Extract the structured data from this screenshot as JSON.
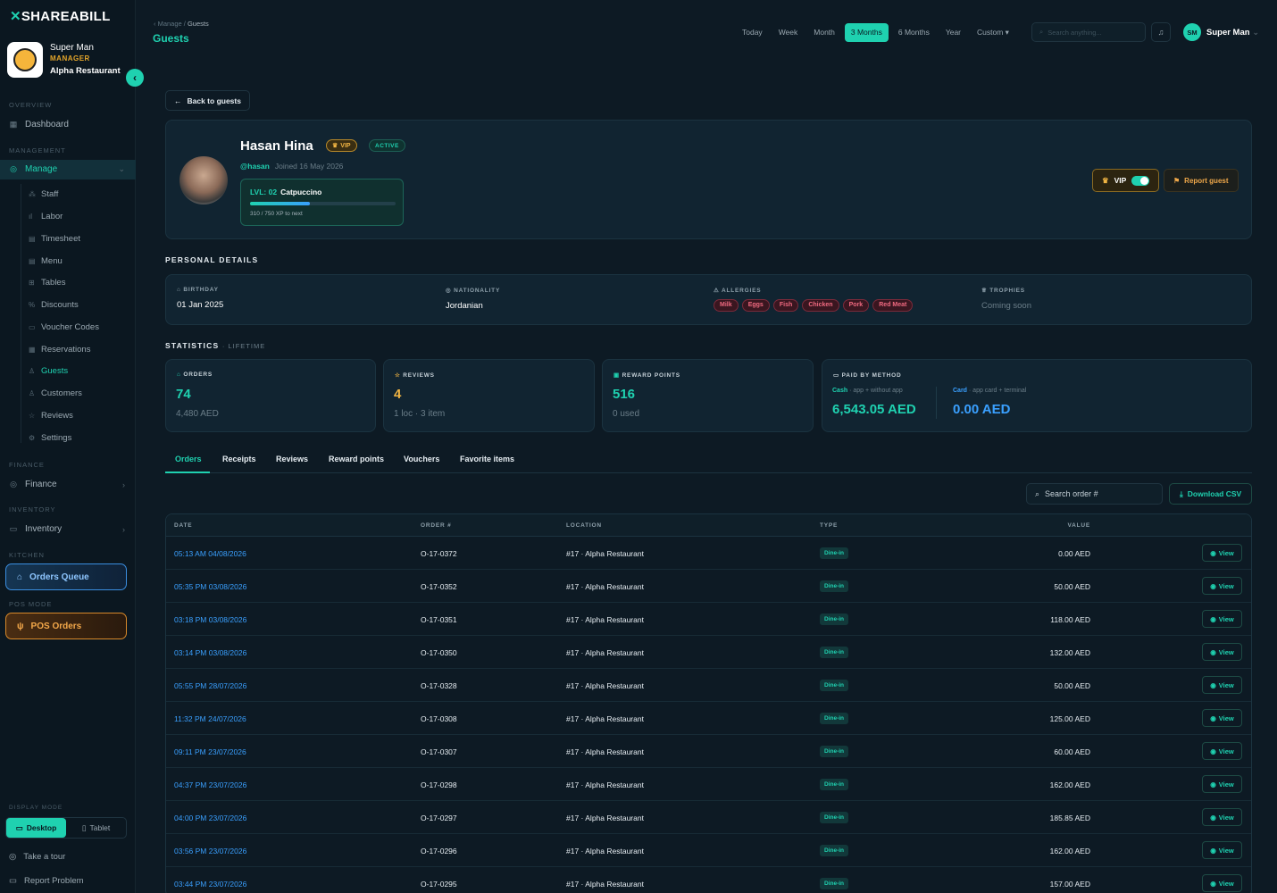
{
  "brand": {
    "logo": "SHAREABILL",
    "logo_mark": "✕"
  },
  "profile": {
    "name": "Super Man",
    "role": "MANAGER",
    "restaurant": "Alpha Restaurant"
  },
  "sidebar": {
    "overview_label": "OVERVIEW",
    "dashboard": "Dashboard",
    "management_label": "MANAGEMENT",
    "manage": "Manage",
    "subitems": [
      "Staff",
      "Labor",
      "Timesheet",
      "Menu",
      "Tables",
      "Discounts",
      "Voucher Codes",
      "Reservations",
      "Guests",
      "Customers",
      "Reviews",
      "Settings"
    ],
    "finance_label": "FINANCE",
    "finance": "Finance",
    "inventory_label": "INVENTORY",
    "inventory": "Inventory",
    "kitchen_label": "KITCHEN",
    "orders_queue": "Orders Queue",
    "pos_label": "POS MODE",
    "pos_orders": "POS Orders",
    "display_mode_label": "DISPLAY MODE",
    "desktop": "Desktop",
    "tablet": "Tablet",
    "take_tour": "Take a tour",
    "report_problem": "Report Problem"
  },
  "header": {
    "breadcrumb_parent": "Manage",
    "breadcrumb_current": "Guests",
    "title": "Guests",
    "ranges": [
      "Today",
      "Week",
      "Month",
      "3 Months",
      "6 Months",
      "Year",
      "Custom ▾"
    ],
    "active_range": "3 Months",
    "search_placeholder": "Search anything...",
    "user_initials": "SM",
    "user_name": "Super Man"
  },
  "guest": {
    "back_label": "Back to guests",
    "name": "Hasan Hina",
    "vip_badge": "VIP",
    "status": "ACTIVE",
    "handle": "@hasan",
    "joined": "Joined 16 May 2026",
    "level_prefix": "LVL: 02",
    "level_name": "Catpuccino",
    "xp_text": "310 / 750 XP to next",
    "xp_progress": 0.413,
    "vip_toggle_label": "VIP",
    "vip_enabled": true,
    "report_label": "Report guest"
  },
  "personal": {
    "heading": "PERSONAL DETAILS",
    "birthday_label": "BIRTHDAY",
    "birthday": "01 Jan 2025",
    "nationality_label": "NATIONALITY",
    "nationality": "Jordanian",
    "allergies_label": "ALLERGIES",
    "allergies": [
      "Milk",
      "Eggs",
      "Fish",
      "Chicken",
      "Pork",
      "Red Meat"
    ],
    "trophies_label": "TROPHIES",
    "trophies": "Coming soon"
  },
  "statistics": {
    "heading": "STATISTICS",
    "subheading": "· LIFETIME",
    "orders_label": "ORDERS",
    "orders": "74",
    "orders_sub": "4,480 AED",
    "reviews_label": "REVIEWS",
    "reviews": "4",
    "reviews_sub": "1 loc · 3 item",
    "reward_label": "REWARD POINTS",
    "reward": "516",
    "reward_sub": "0 used",
    "paid_label": "PAID BY METHOD",
    "cash_label": "Cash",
    "cash_note": "· app + without app",
    "cash_amount": "6,543.05 AED",
    "card_label": "Card",
    "card_note": "· app card + terminal",
    "card_amount": "0.00 AED"
  },
  "tabs": [
    "Orders",
    "Receipts",
    "Reviews",
    "Reward points",
    "Vouchers",
    "Favorite items"
  ],
  "orders_toolbar": {
    "search_placeholder": "Search order #",
    "csv_label": "Download CSV"
  },
  "table": {
    "headers": [
      "DATE",
      "ORDER #",
      "LOCATION",
      "TYPE",
      "VALUE"
    ],
    "view_label": "View",
    "rows": [
      {
        "time": "05:13 AM",
        "date": "04/08/2026",
        "order": "O-17-0372",
        "location": "#17 · Alpha Restaurant",
        "type": "Dine-in",
        "value": "0.00 AED"
      },
      {
        "time": "05:35 PM",
        "date": "03/08/2026",
        "order": "O-17-0352",
        "location": "#17 · Alpha Restaurant",
        "type": "Dine-in",
        "value": "50.00 AED"
      },
      {
        "time": "03:18 PM",
        "date": "03/08/2026",
        "order": "O-17-0351",
        "location": "#17 · Alpha Restaurant",
        "type": "Dine-in",
        "value": "118.00 AED"
      },
      {
        "time": "03:14 PM",
        "date": "03/08/2026",
        "order": "O-17-0350",
        "location": "#17 · Alpha Restaurant",
        "type": "Dine-in",
        "value": "132.00 AED"
      },
      {
        "time": "05:55 PM",
        "date": "28/07/2026",
        "order": "O-17-0328",
        "location": "#17 · Alpha Restaurant",
        "type": "Dine-in",
        "value": "50.00 AED"
      },
      {
        "time": "11:32 PM",
        "date": "24/07/2026",
        "order": "O-17-0308",
        "location": "#17 · Alpha Restaurant",
        "type": "Dine-in",
        "value": "125.00 AED"
      },
      {
        "time": "09:11 PM",
        "date": "23/07/2026",
        "order": "O-17-0307",
        "location": "#17 · Alpha Restaurant",
        "type": "Dine-in",
        "value": "60.00 AED"
      },
      {
        "time": "04:37 PM",
        "date": "23/07/2026",
        "order": "O-17-0298",
        "location": "#17 · Alpha Restaurant",
        "type": "Dine-in",
        "value": "162.00 AED"
      },
      {
        "time": "04:00 PM",
        "date": "23/07/2026",
        "order": "O-17-0297",
        "location": "#17 · Alpha Restaurant",
        "type": "Dine-in",
        "value": "185.85 AED"
      },
      {
        "time": "03:56 PM",
        "date": "23/07/2026",
        "order": "O-17-0296",
        "location": "#17 · Alpha Restaurant",
        "type": "Dine-in",
        "value": "162.00 AED"
      },
      {
        "time": "03:44 PM",
        "date": "23/07/2026",
        "order": "O-17-0295",
        "location": "#17 · Alpha Restaurant",
        "type": "Dine-in",
        "value": "157.00 AED"
      }
    ]
  },
  "colors": {
    "accent": "#1fd1b0",
    "background": "#0d1a24",
    "vip": "#f0b443",
    "allergy": "#f06a80",
    "date": "#3aa0ff"
  }
}
